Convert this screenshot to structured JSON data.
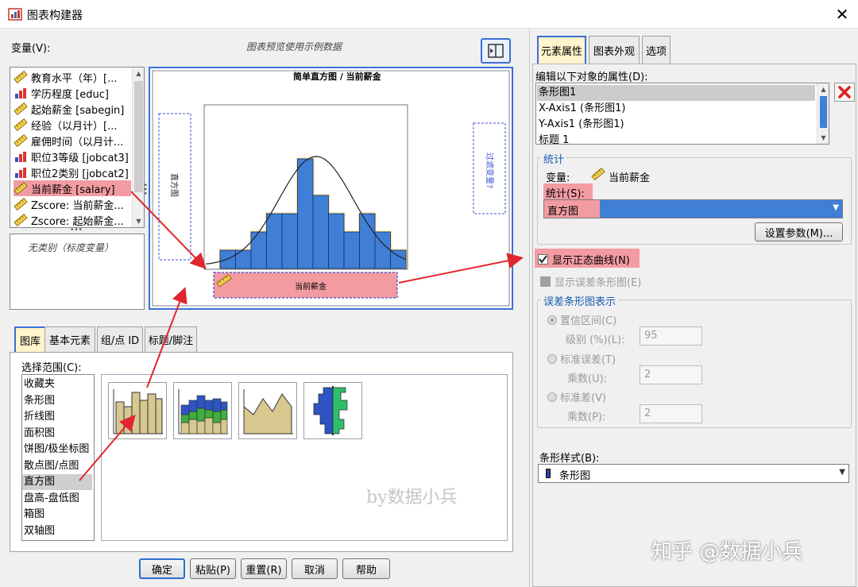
{
  "window": {
    "title": "图表构建器",
    "close_glyph": "✕"
  },
  "variables_label": "变量(V):",
  "preview_note": "图表预览使用示例数据",
  "variables": [
    {
      "label": "教育水平（年）[...",
      "icon": "ruler-icon"
    },
    {
      "label": "学历程度 [educ]",
      "icon": "bar-icon"
    },
    {
      "label": "起始薪金 [sabegin]",
      "icon": "ruler-icon"
    },
    {
      "label": "经验（以月计）[...",
      "icon": "ruler-icon"
    },
    {
      "label": "雇佣时间（以月计...",
      "icon": "ruler-icon"
    },
    {
      "label": "职位3等级 [jobcat3]",
      "icon": "bar-icon"
    },
    {
      "label": "职位2类别 [jobcat2]",
      "icon": "bar-icon"
    },
    {
      "label": "当前薪金 [salary]",
      "icon": "ruler-icon",
      "selected": true
    },
    {
      "label": "Zscore: 当前薪金...",
      "icon": "ruler-icon"
    },
    {
      "label": "Zscore: 起始薪金...",
      "icon": "ruler-icon"
    }
  ],
  "no_categories": "无类别（标度变量）",
  "canvas": {
    "chart_title": "简单直方图 / 当前薪金",
    "y_dropzone": "直方图",
    "right_dropzone": "过滤变量?",
    "x_axis_variable": "当前薪金"
  },
  "chart_data": {
    "type": "bar",
    "title": "简单直方图 / 当前薪金",
    "values": [
      1,
      1,
      2,
      3,
      3,
      6,
      4,
      3,
      2,
      3,
      2,
      1
    ],
    "normal_curve": true,
    "xlabel": "当前薪金",
    "ylabel": "直方图"
  },
  "lower_tabs": [
    {
      "label": "图库",
      "active": true
    },
    {
      "label": "基本元素"
    },
    {
      "label": "组/点 ID"
    },
    {
      "label": "标题/脚注"
    }
  ],
  "choose_from_label": "选择范围(C):",
  "chart_types": [
    "收藏夹",
    "条形图",
    "折线图",
    "面积图",
    "饼图/极坐标图",
    "散点图/点图",
    "直方图",
    "盘高-盘低图",
    "箱图",
    "双轴图"
  ],
  "chart_types_selected": "直方图",
  "gallery": [
    {
      "name": "simple-histogram-thumb"
    },
    {
      "name": "stacked-histogram-thumb"
    },
    {
      "name": "frequency-polygon-thumb"
    },
    {
      "name": "population-pyramid-thumb"
    }
  ],
  "watermark_by": "by数据小兵",
  "buttons": {
    "ok": "确定",
    "paste": "粘贴(P)",
    "reset": "重置(R)",
    "cancel": "取消",
    "help": "帮助"
  },
  "right_tabs": [
    {
      "label": "元素属性",
      "active": true
    },
    {
      "label": "图表外观"
    },
    {
      "label": "选项"
    }
  ],
  "edit_props_label": "编辑以下对象的属性(D):",
  "prop_objects": [
    "条形图1",
    "X-Axis1 (条形图1)",
    "Y-Axis1 (条形图1)",
    "标题 1"
  ],
  "stats": {
    "legend": "统计",
    "variable_label": "变量:",
    "variable_value": "当前薪金",
    "stat_label": "统计(S):",
    "stat_value": "直方图",
    "set_params": "设置参数(M)..."
  },
  "show_normal": "显示正态曲线(N)",
  "show_error_bars": "显示误差条形图(E)",
  "error_bars": {
    "legend": "误差条形图表示",
    "ci_label": "置信区间(C)",
    "level_label": "级别 (%)(L):",
    "level_value": "95",
    "se_label": "标准误差(T)",
    "se_mult_label": "乘数(U):",
    "se_mult_value": "2",
    "sd_label": "标准差(V)",
    "sd_mult_label": "乘数(P):",
    "sd_mult_value": "2"
  },
  "bar_style_label": "条形样式(B):",
  "bar_style_value": "条形图",
  "watermark_zhihu": "知乎 @数据小兵",
  "colors": {
    "accent_blue": "#3f7fd6",
    "highlight_pink": "#f29ca2",
    "arrow_red": "#e0262e"
  }
}
